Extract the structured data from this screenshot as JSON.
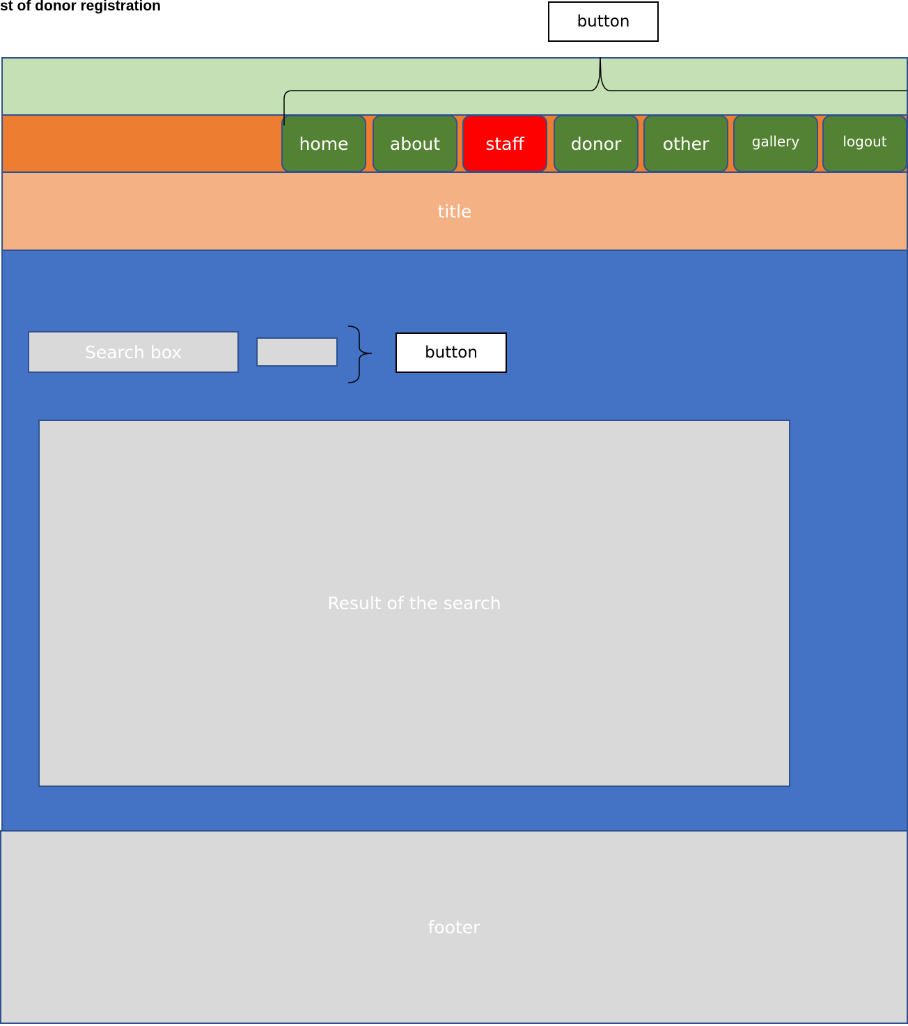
{
  "page": {
    "heading": "st of donor registration"
  },
  "callouts": {
    "top_button": "button",
    "search_button": "button"
  },
  "nav": {
    "items": [
      {
        "label": "home",
        "color": "#548235"
      },
      {
        "label": "about",
        "color": "#548235"
      },
      {
        "label": "staff",
        "color": "#ff0000"
      },
      {
        "label": "donor",
        "color": "#548235"
      },
      {
        "label": "other",
        "color": "#548235"
      },
      {
        "label": "gallery",
        "color": "#548235"
      },
      {
        "label": "logout",
        "color": "#548235"
      }
    ]
  },
  "title_band": {
    "label": "title"
  },
  "search": {
    "box_label": "Search box",
    "secondary_box_label": ""
  },
  "results": {
    "label": "Result of the search"
  },
  "footer": {
    "label": "footer"
  },
  "colors": {
    "header_green": "#c5e0b4",
    "nav_orange": "#ed7d31",
    "title_peach": "#f4b183",
    "content_blue": "#4472c4",
    "box_grey": "#d9d9d9",
    "outline_blue": "#2f528f",
    "nav_green": "#548235",
    "nav_active_red": "#ff0000"
  }
}
